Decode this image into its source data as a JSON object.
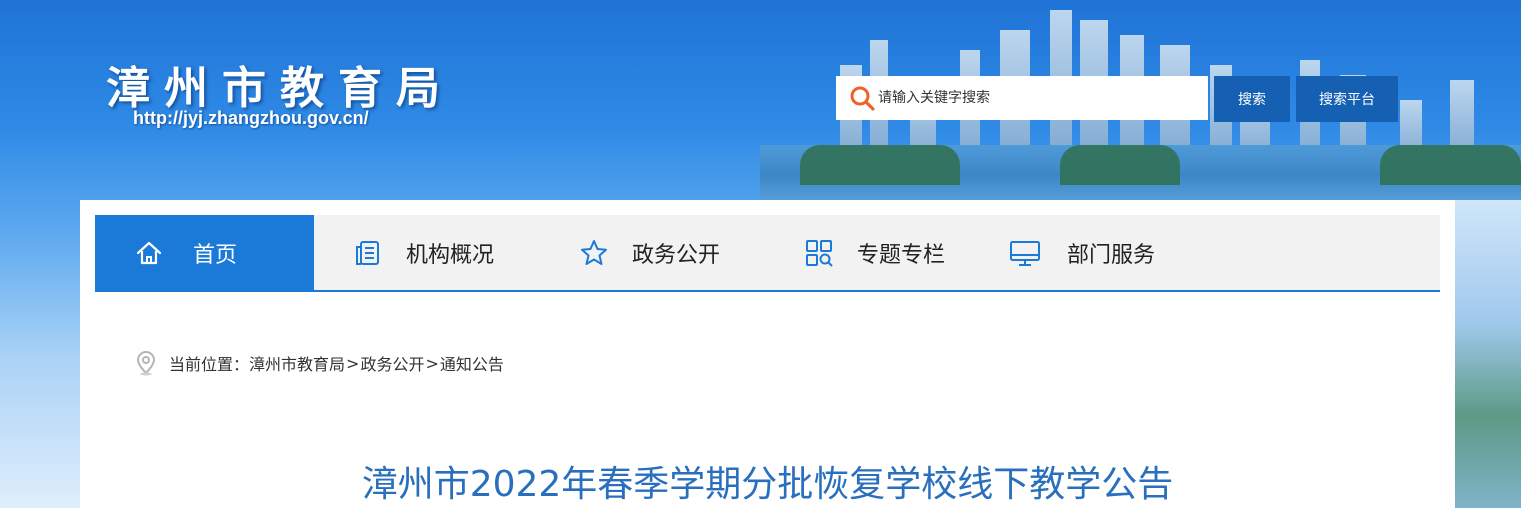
{
  "header": {
    "site_title": "漳州市教育局",
    "site_url": "http://jyj.zhangzhou.gov.cn/",
    "search_placeholder": "请输入关键字搜索",
    "search_button": "搜索",
    "platform_button": "搜索平台"
  },
  "nav": {
    "items": [
      {
        "label": "首页",
        "icon": "home-icon",
        "active": true
      },
      {
        "label": "机构概况",
        "icon": "document-icon",
        "active": false
      },
      {
        "label": "政务公开",
        "icon": "star-icon",
        "active": false
      },
      {
        "label": "专题专栏",
        "icon": "grid-search-icon",
        "active": false
      },
      {
        "label": "部门服务",
        "icon": "monitor-icon",
        "active": false
      }
    ]
  },
  "breadcrumb": {
    "prefix": "当前位置：",
    "items": [
      "漳州市教育局",
      "政务公开",
      "通知公告"
    ],
    "separator": ">"
  },
  "article": {
    "title": "漳州市2022年春季学期分批恢复学校线下教学公告"
  },
  "colors": {
    "accent": "#1b7ad8",
    "button": "#1660b4",
    "title": "#2a6fbd"
  }
}
